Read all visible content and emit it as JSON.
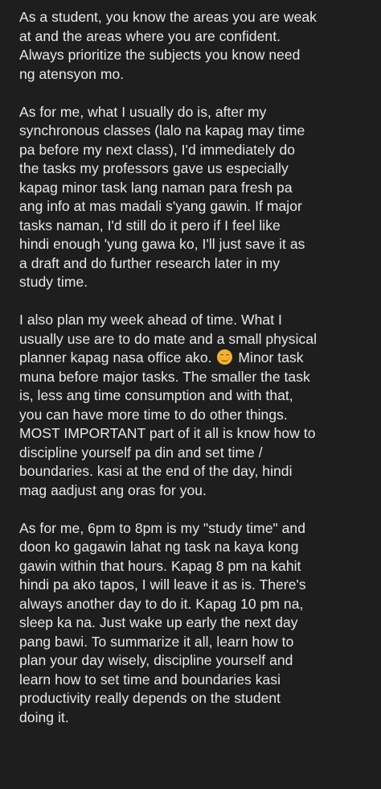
{
  "post": {
    "paragraphs": [
      {
        "lines": [
          "As a student, you know the areas you are weak",
          "at and the areas where you are confident.",
          "Always prioritize the subjects you know need",
          "ng atensyon mo."
        ]
      },
      {
        "lines": [
          "As for me, what I usually do is, after my",
          "synchronous classes (lalo na kapag may time",
          "pa before my next class), I'd immediately do",
          "the tasks my professors gave us especially",
          "kapag minor task lang naman para fresh pa",
          "ang info at mas madali s'yang gawin. If major",
          "tasks naman, I'd still do it pero if I feel like",
          "hindi enough 'yung gawa ko, I'll just save it as",
          "a draft and do further research later in my",
          "study time."
        ]
      },
      {
        "lines": [
          "I also plan my week ahead of time. What I",
          "usually use are to do mate and a small physical",
          "planner kapag nasa office ako.",
          "muna before major tasks. The smaller the task",
          "is, less ang time consumption and with that,",
          "you can have more time to do other things.",
          "MOST IMPORTANT part of it all is know how to",
          "discipline yourself pa din and set time /",
          "boundaries. kasi at the end of the day, hindi",
          "mag aadjust ang oras for you."
        ],
        "inline_tail": "Minor task",
        "inline_emoji": "smiling-face-emoji"
      },
      {
        "lines": [
          "As for me, 6pm to 8pm is my \"study time\" and",
          "doon ko gagawin lahat ng task na kaya kong",
          "gawin within that hours. Kapag 8 pm na kahit",
          "hindi pa ako tapos, I will leave it as is. There's",
          "always another day to do it. Kapag 10 pm na,",
          "sleep ka na. Just wake up early the next day",
          "pang bawi. To summarize it all, learn how to",
          "plan your day wisely, discipline yourself and",
          "learn how to set time and boundaries kasi",
          "productivity really depends on the student",
          "doing it."
        ]
      }
    ]
  },
  "colors": {
    "background": "#1e1e1e",
    "text": "#e8e8e8"
  }
}
